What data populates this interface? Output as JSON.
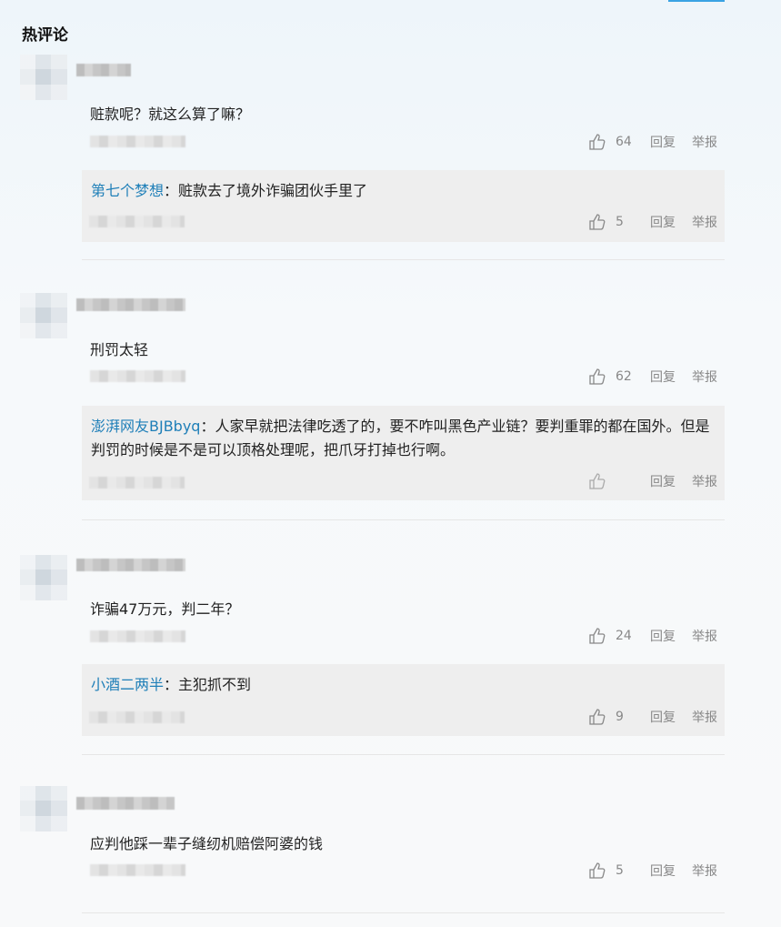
{
  "section_title": "热评论",
  "colors": {
    "link": "#1f7fb8",
    "reply_bg": "#eeeeee",
    "accent": "#3aa3e3"
  },
  "actions": {
    "reply": "回复",
    "report": "举报",
    "like_icon": "thumbs-up-icon"
  },
  "comments": [
    {
      "content": "赃款呢？就这么算了嘛？",
      "likes": "64",
      "reply": {
        "user": "第七个梦想",
        "sep": "：",
        "text": "赃款去了境外诈骗团伙手里了",
        "likes": "5"
      }
    },
    {
      "content": "刑罚太轻",
      "likes": "62",
      "reply": {
        "user": "澎湃网友BJBbyq",
        "sep": "：",
        "text": "人家早就把法律吃透了的，要不咋叫黑色产业链？要判重罪的都在国外。但是判罚的时候是不是可以顶格处理呢，把爪牙打掉也行啊。",
        "likes": ""
      }
    },
    {
      "content": "诈骗47万元，判二年？",
      "likes": "24",
      "reply": {
        "user": "小酒二两半",
        "sep": "：",
        "text": "主犯抓不到",
        "likes": "9"
      }
    },
    {
      "content": "应判他踩一辈子缝纫机赔偿阿婆的钱",
      "likes": "5"
    }
  ]
}
